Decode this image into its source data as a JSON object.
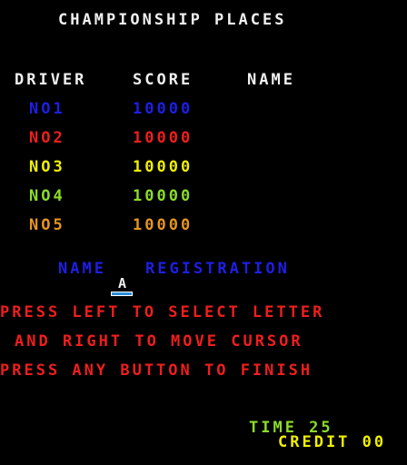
{
  "title": "CHAMPIONSHIP PLACES",
  "headers": {
    "driver": "DRIVER",
    "score": "SCORE",
    "name": "NAME"
  },
  "rows": [
    {
      "rank": "NO1",
      "score": "10000",
      "name": "",
      "color": "#1e1ee6"
    },
    {
      "rank": "NO2",
      "score": "10000",
      "name": "",
      "color": "#f01e1e"
    },
    {
      "rank": "NO3",
      "score": "10000",
      "name": "",
      "color": "#f0f000"
    },
    {
      "rank": "NO4",
      "score": "10000",
      "name": "",
      "color": "#8cdc28"
    },
    {
      "rank": "NO5",
      "score": "10000",
      "name": "",
      "color": "#e6961e"
    }
  ],
  "registration": {
    "label_name": "NAME",
    "label_registration": "REGISTRATION",
    "current_letter": "A"
  },
  "instructions": [
    "PRESS LEFT TO SELECT LETTER",
    "AND RIGHT TO MOVE CURSOR",
    "PRESS ANY BUTTON TO FINISH"
  ],
  "timer": {
    "label": "TIME 25"
  },
  "credit": {
    "label": "CREDIT 00"
  }
}
